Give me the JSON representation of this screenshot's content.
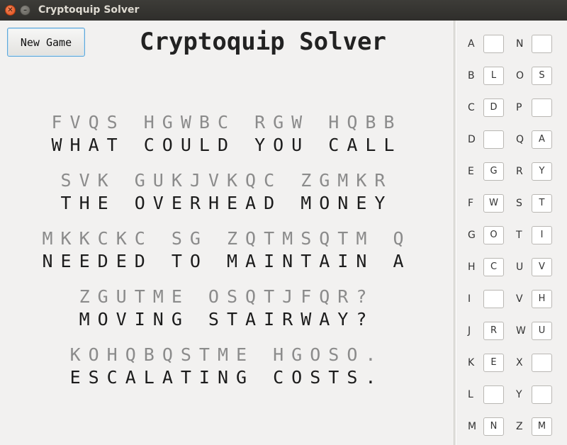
{
  "window": {
    "title": "Cryptoquip Solver"
  },
  "toolbar": {
    "new_game_label": "New Game"
  },
  "app_title": "Cryptoquip Solver",
  "puzzle": [
    {
      "cipher": "FVQS HGWBC RGW HQBB",
      "plain": "WHAT COULD YOU CALL"
    },
    {
      "cipher": "SVK GUKJVKQC ZGMKR",
      "plain": "THE OVERHEAD MONEY"
    },
    {
      "cipher": "MKKCKC SG ZQTMSQTM Q",
      "plain": "NEEDED TO MAINTAIN A"
    },
    {
      "cipher": "ZGUTME OSQTJFQR?",
      "plain": "MOVING STAIRWAY?"
    },
    {
      "cipher": "KOHQBQSTME HGOSO.",
      "plain": "ESCALATING COSTS."
    }
  ],
  "key_left": [
    {
      "letter": "A",
      "value": ""
    },
    {
      "letter": "B",
      "value": "L"
    },
    {
      "letter": "C",
      "value": "D"
    },
    {
      "letter": "D",
      "value": ""
    },
    {
      "letter": "E",
      "value": "G"
    },
    {
      "letter": "F",
      "value": "W"
    },
    {
      "letter": "G",
      "value": "O"
    },
    {
      "letter": "H",
      "value": "C"
    },
    {
      "letter": "I",
      "value": ""
    },
    {
      "letter": "J",
      "value": "R"
    },
    {
      "letter": "K",
      "value": "E"
    },
    {
      "letter": "L",
      "value": ""
    },
    {
      "letter": "M",
      "value": "N"
    }
  ],
  "key_right": [
    {
      "letter": "N",
      "value": ""
    },
    {
      "letter": "O",
      "value": "S"
    },
    {
      "letter": "P",
      "value": ""
    },
    {
      "letter": "Q",
      "value": "A"
    },
    {
      "letter": "R",
      "value": "Y"
    },
    {
      "letter": "S",
      "value": "T"
    },
    {
      "letter": "T",
      "value": "I"
    },
    {
      "letter": "U",
      "value": "V"
    },
    {
      "letter": "V",
      "value": "H"
    },
    {
      "letter": "W",
      "value": "U"
    },
    {
      "letter": "X",
      "value": ""
    },
    {
      "letter": "Y",
      "value": ""
    },
    {
      "letter": "Z",
      "value": "M"
    }
  ]
}
